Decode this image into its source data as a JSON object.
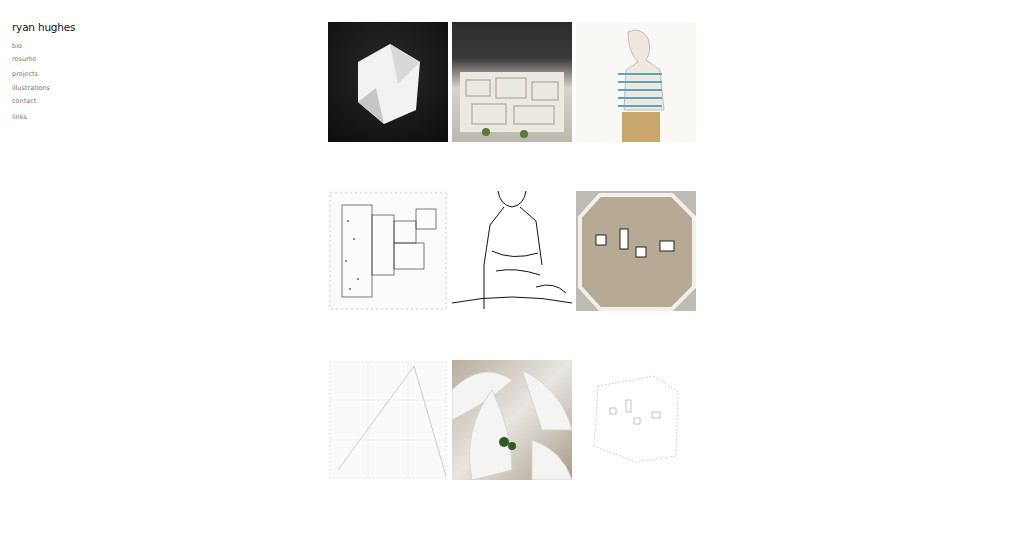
{
  "site": {
    "title": "ryan hughes"
  },
  "nav": [
    {
      "label": "bio"
    },
    {
      "label": "resume"
    },
    {
      "label": "projects"
    },
    {
      "label": "illustrations"
    },
    {
      "label": "contact"
    },
    {
      "label": "links"
    }
  ]
}
